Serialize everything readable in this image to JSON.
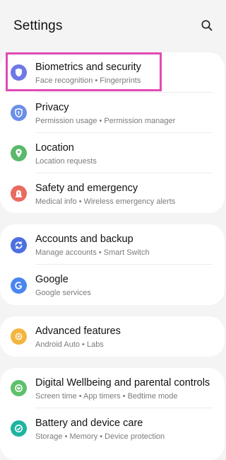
{
  "header": {
    "title": "Settings",
    "search_icon": "search-icon"
  },
  "groups": [
    {
      "items": [
        {
          "label": "Biometrics and security",
          "sub": "Face recognition  •  Fingerprints",
          "icon": "shield-icon",
          "color": "#6f78e6"
        },
        {
          "label": "Privacy",
          "sub": "Permission usage  •  Permission manager",
          "icon": "privacy-shield-icon",
          "color": "#6b8fe8"
        },
        {
          "label": "Location",
          "sub": "Location requests",
          "icon": "location-pin-icon",
          "color": "#5bb96a"
        },
        {
          "label": "Safety and emergency",
          "sub": "Medical info  •  Wireless emergency alerts",
          "icon": "emergency-icon",
          "color": "#ea6a5f"
        }
      ]
    },
    {
      "items": [
        {
          "label": "Accounts and backup",
          "sub": "Manage accounts  •  Smart Switch",
          "icon": "sync-icon",
          "color": "#4d6fe0"
        },
        {
          "label": "Google",
          "sub": "Google services",
          "icon": "google-icon",
          "color": "#4b86ef"
        }
      ]
    },
    {
      "items": [
        {
          "label": "Advanced features",
          "sub": "Android Auto  •  Labs",
          "icon": "gear-plus-icon",
          "color": "#f4b53f"
        }
      ]
    },
    {
      "items": [
        {
          "label": "Digital Wellbeing and parental controls",
          "sub": "Screen time  •  App timers  •  Bedtime mode",
          "icon": "wellbeing-icon",
          "color": "#5ec06b"
        },
        {
          "label": "Battery and device care",
          "sub": "Storage  •  Memory  •  Device protection",
          "icon": "device-care-icon",
          "color": "#1eb5a0"
        }
      ]
    }
  ],
  "highlight_color": "#e34ab4"
}
